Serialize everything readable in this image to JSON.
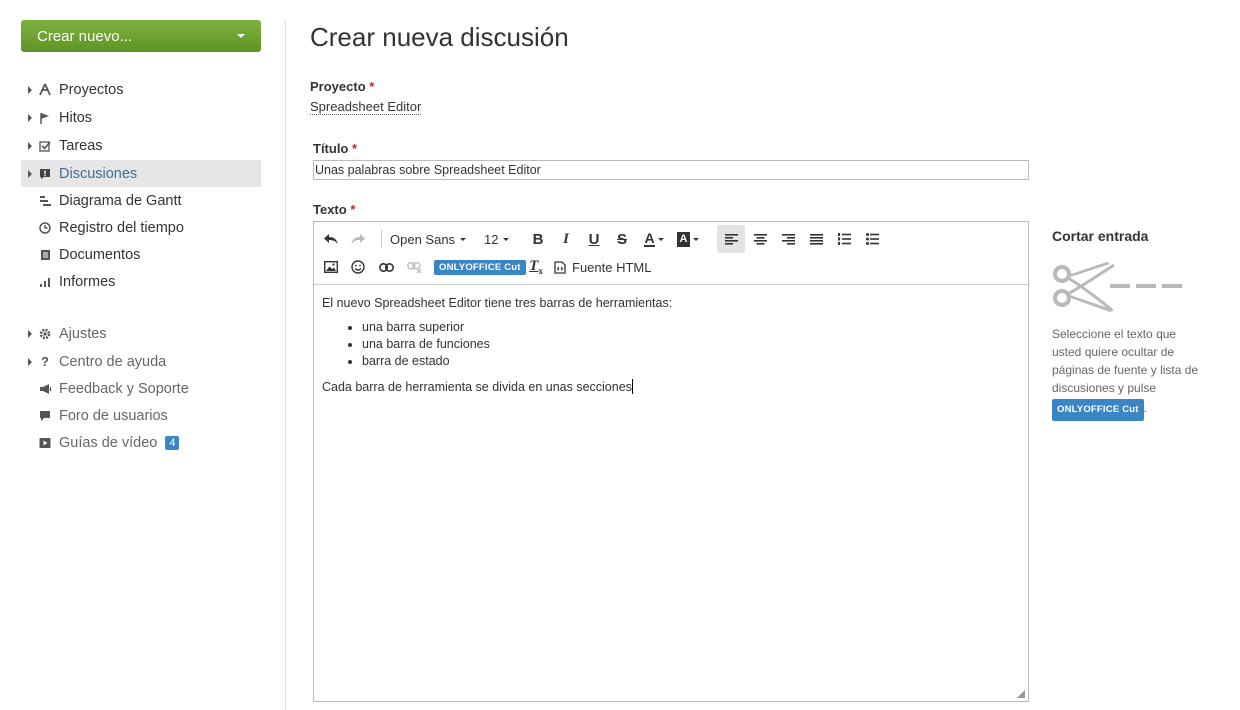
{
  "sidebar": {
    "create_button": "Crear nuevo...",
    "items": [
      {
        "label": "Proyectos",
        "icon": "projects-icon",
        "expandable": true,
        "active": false
      },
      {
        "label": "Hitos",
        "icon": "flag-icon",
        "expandable": true,
        "active": false
      },
      {
        "label": "Tareas",
        "icon": "checkbox-icon",
        "expandable": true,
        "active": false
      },
      {
        "label": "Discusiones",
        "icon": "discussion-icon",
        "expandable": true,
        "active": true
      },
      {
        "label": "Diagrama de Gantt",
        "icon": "gantt-icon",
        "expandable": false,
        "active": false
      },
      {
        "label": "Registro del tiempo",
        "icon": "clock-icon",
        "expandable": false,
        "active": false
      },
      {
        "label": "Documentos",
        "icon": "document-icon",
        "expandable": false,
        "active": false
      },
      {
        "label": "Informes",
        "icon": "chart-icon",
        "expandable": false,
        "active": false
      }
    ],
    "secondary": [
      {
        "label": "Ajustes",
        "icon": "gear-icon",
        "expandable": true
      },
      {
        "label": "Centro de ayuda",
        "icon": "question-icon",
        "expandable": true
      },
      {
        "label": "Feedback y Soporte",
        "icon": "megaphone-icon",
        "expandable": false
      },
      {
        "label": "Foro de usuarios",
        "icon": "chat-icon",
        "expandable": false
      },
      {
        "label": "Guías de vídeo",
        "icon": "video-icon",
        "expandable": false,
        "badge": "4"
      }
    ]
  },
  "main": {
    "title": "Crear nueva discusión",
    "project_label": "Proyecto",
    "project_value": "Spreadsheet Editor",
    "title_label": "Título",
    "title_value": "Unas palabras sobre Spreadsheet Editor",
    "text_label": "Texto",
    "required_mark": "*"
  },
  "editor": {
    "font_family": "Open Sans",
    "font_size": "12",
    "cut_button": "ONLYOFFICE Cut",
    "source_button": "Fuente HTML",
    "content": {
      "intro": "El nuevo Spreadsheet Editor tiene tres barras de herramientas:",
      "list": [
        "una barra superior",
        "una barra de funciones",
        "barra de estado"
      ],
      "outro": "Cada barra de herramienta se divida en unas secciones"
    }
  },
  "cut_panel": {
    "title": "Cortar entrada",
    "description": "Seleccione el texto que usted quiere ocultar de páginas de fuente y lista de discusiones y pulse",
    "badge": "ONLYOFFICE Cut",
    "suffix": "."
  },
  "colors": {
    "accent_green": "#6aa330",
    "link_blue": "#3d6d96",
    "badge_blue": "#3a86c4",
    "required_red": "#c0262a"
  }
}
